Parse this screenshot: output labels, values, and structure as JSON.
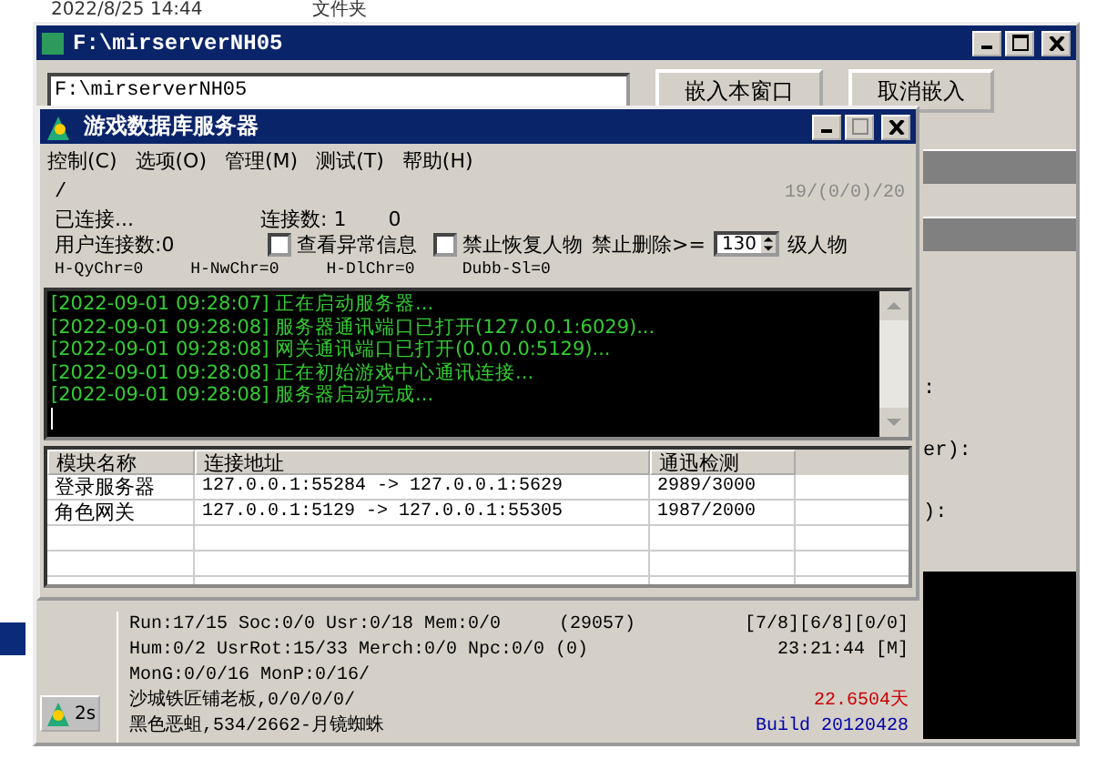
{
  "desktop": {
    "timestamp": "2022/8/25 14:44",
    "label": "文件夹"
  },
  "outer_window": {
    "title": "F:\\mirserverNH05",
    "path_field": {
      "value": "F:\\mirserverNH05"
    },
    "buttons": [
      "嵌入本窗口",
      "取消嵌入"
    ],
    "background_fragments": [
      ":",
      "er):",
      "):"
    ]
  },
  "inner_window": {
    "title": "游戏数据库服务器",
    "menu": [
      "控制(C)",
      "选项(O)",
      "管理(M)",
      "测试(T)",
      "帮助(H)"
    ],
    "path": "/",
    "counter": "19/(0/0)/20",
    "connected": "已连接...",
    "connection_count": "连接数: 1",
    "connection_count_2": "0",
    "user_connections": "用户连接数:0",
    "checkboxes": [
      {
        "label": "查看异常信息",
        "checked": false
      },
      {
        "label": "禁止恢复人物",
        "checked": false
      }
    ],
    "delete_limit": {
      "label": "禁止删除>=",
      "value": "130",
      "suffix": "级人物"
    },
    "stats": [
      "H-QyChr=0",
      "H-NwChr=0",
      "H-DlChr=0",
      "Dubb-Sl=0"
    ],
    "log": [
      "[2022-09-01 09:28:07] 正在启动服务器...",
      "[2022-09-01 09:28:08] 服务器通讯端口已打开(127.0.0.1:6029)...",
      "[2022-09-01 09:28:08] 网关通讯端口已打开(0.0.0.0:5129)...",
      "[2022-09-01 09:28:08] 正在初始游戏中心通讯连接...",
      "[2022-09-01 09:28:08] 服务器启动完成..."
    ],
    "table": {
      "columns": [
        "模块名称",
        "连接地址",
        "通迅检测"
      ],
      "rows": [
        [
          "登录服务器",
          "127.0.0.1:55284 -> 127.0.0.1:5629",
          "2989/3000"
        ],
        [
          "角色网关",
          "127.0.0.1:5129 -> 127.0.0.1:55305",
          "1987/2000"
        ]
      ]
    }
  },
  "status_panel": {
    "icon_label": "2s",
    "lines": [
      {
        "left": "Run:17/15 Soc:0/0 Usr:0/18 Mem:0/0",
        "middle": "(29057)",
        "right": "[7/8][6/8][0/0]",
        "kind": "plain"
      },
      {
        "left": "Hum:0/2 UsrRot:15/33 Merch:0/0 Npc:0/0 (0)",
        "right": "23:21:44 [M]",
        "kind": "plain"
      },
      {
        "left": "MonG:0/0/16 MonP:0/16/"
      },
      {
        "left": "沙城铁匠铺老板,0/0/0/0/",
        "right": "22.6504天",
        "kind": "red"
      },
      {
        "left": "黑色恶蛆,534/2662-月镜蜘蛛",
        "right": "Build 20120428",
        "kind": "blue"
      }
    ]
  }
}
